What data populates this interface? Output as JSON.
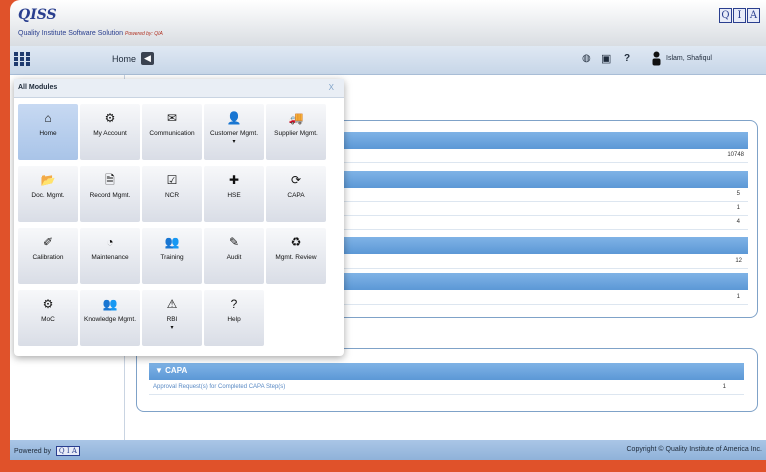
{
  "header": {
    "logo_text": "QISS",
    "tagline": "Quality Institute Software Solution",
    "tagline_powered": "Powered by: QIA",
    "brand_letters": [
      "Q",
      "I",
      "A"
    ]
  },
  "nav": {
    "home_label": "Home",
    "back_icon": "arrow-left-icon",
    "help_label": "?",
    "user_name": "Islam, Shafiqul"
  },
  "modules": {
    "title": "All Modules",
    "close_label": "X",
    "tiles": [
      {
        "label": "Home",
        "icon": "⌂",
        "active": true
      },
      {
        "label": "My Account",
        "icon": "⚙"
      },
      {
        "label": "Communication",
        "icon": "✉"
      },
      {
        "label": "Customer Mgmt.",
        "icon": "👤",
        "caret": "▾"
      },
      {
        "label": "Supplier Mgmt.",
        "icon": "🚚"
      },
      {
        "label": "Doc. Mgmt.",
        "icon": "📂"
      },
      {
        "label": "Record Mgmt.",
        "icon": "🗎"
      },
      {
        "label": "NCR",
        "icon": "☑"
      },
      {
        "label": "HSE",
        "icon": "✚"
      },
      {
        "label": "CAPA",
        "icon": "⟳"
      },
      {
        "label": "Calibration",
        "icon": "✐"
      },
      {
        "label": "Maintenance",
        "icon": "◔"
      },
      {
        "label": "Training",
        "icon": "👥"
      },
      {
        "label": "Audit",
        "icon": "✎"
      },
      {
        "label": "Mgmt. Review",
        "icon": "♻"
      },
      {
        "label": "MoC",
        "icon": "⚙"
      },
      {
        "label": "Knowledge Mgmt.",
        "icon": "👥"
      },
      {
        "label": "RBI",
        "icon": "⚠",
        "caret": "▾"
      },
      {
        "label": "Help",
        "icon": "?"
      }
    ]
  },
  "dashboard": {
    "values": [
      "10748",
      "5",
      "1",
      "4",
      "12",
      "1"
    ],
    "capa_section": {
      "title": "▼ CAPA",
      "link": "Approval Request(s) for Completed CAPA Step(s)",
      "value": "1"
    }
  },
  "footer": {
    "powered_by": "Powered by",
    "copyright": "Copyright © Quality Institute of America Inc."
  },
  "colors": {
    "accent": "#5c98d6",
    "frame": "#e0522a"
  }
}
